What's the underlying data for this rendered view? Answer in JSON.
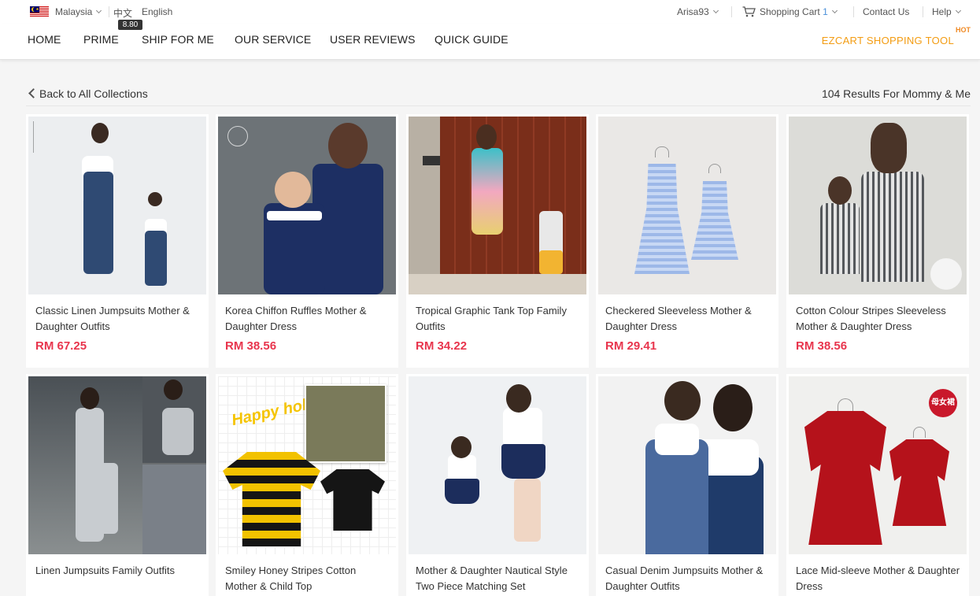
{
  "topbar": {
    "country": "Malaysia",
    "lang_cn": "中文",
    "lang_en": "English",
    "username": "Arisa93",
    "cart_label": "Shopping Cart",
    "cart_count": "1",
    "contact": "Contact Us",
    "help": "Help"
  },
  "nav": {
    "items": [
      "HOME",
      "PRIME",
      "SHIP FOR ME",
      "OUR SERVICE",
      "USER REVIEWS",
      "QUICK GUIDE"
    ],
    "prime_badge": "8.80",
    "ezcart": "EZCART SHOPPING TOOL",
    "hot": "HOT"
  },
  "collection": {
    "back": "Back to All Collections",
    "results": "104 Results For Mommy & Me"
  },
  "products": [
    {
      "name": "Classic Linen Jumpsuits Mother & Daughter Outfits",
      "price": "RM 67.25"
    },
    {
      "name": "Korea Chiffon Ruffles Mother & Daughter Dress",
      "price": "RM 38.56"
    },
    {
      "name": "Tropical Graphic Tank Top Family Outfits",
      "price": "RM 34.22"
    },
    {
      "name": "Checkered Sleeveless Mother & Daughter Dress",
      "price": "RM 29.41"
    },
    {
      "name": "Cotton Colour Stripes Sleeveless Mother & Daughter Dress",
      "price": "RM 38.56"
    },
    {
      "name": "Linen Jumpsuits Family Outfits",
      "price": ""
    },
    {
      "name": "Smiley Honey Stripes Cotton Mother & Child Top",
      "price": ""
    },
    {
      "name": "Mother & Daughter Nautical Style Two Piece Matching Set",
      "price": ""
    },
    {
      "name": "Casual Denim Jumpsuits Mother & Daughter Outfits",
      "price": ""
    },
    {
      "name": "Lace Mid-sleeve Mother & Daughter Dress",
      "price": ""
    }
  ],
  "image_text": {
    "happy": "Happy holidays",
    "badge_cn": "母女裙"
  },
  "colors": {
    "price": "#e8354d",
    "ezcart": "#f39c12",
    "cart_count": "#4a90d9"
  }
}
